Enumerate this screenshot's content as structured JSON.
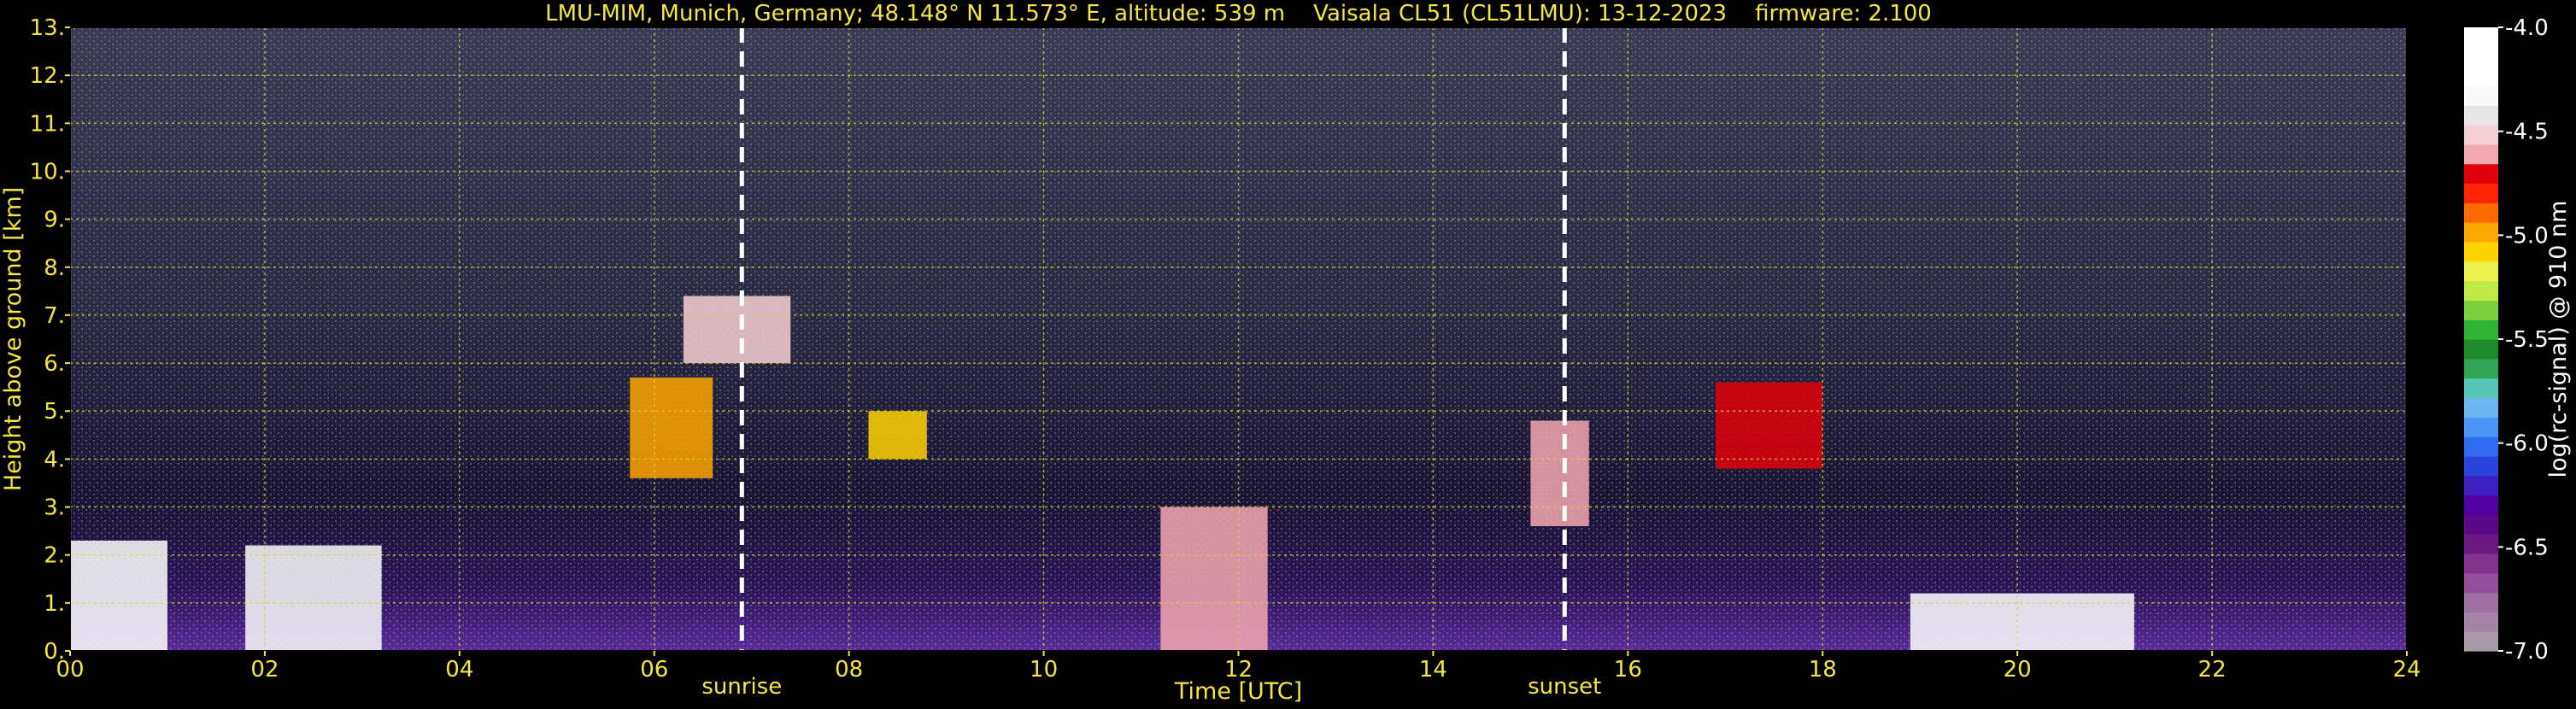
{
  "chart_data": {
    "type": "heatmap",
    "title": "LMU-MIM, Munich, Germany; 48.148° N 11.573° E, altitude: 539 m    Vaisala CL51 (CL51LMU): 13-12-2023    firmware: 2.100",
    "xlabel": "Time [UTC]",
    "ylabel": "Height above ground [km]",
    "xlim": [
      0,
      24
    ],
    "ylim": [
      0,
      13
    ],
    "x_ticks": [
      "00",
      "02",
      "04",
      "06",
      "08",
      "10",
      "12",
      "14",
      "16",
      "18",
      "20",
      "22",
      "24"
    ],
    "y_ticks": [
      "0.",
      "1.",
      "2.",
      "3.",
      "4.",
      "5.",
      "6.",
      "7.",
      "8.",
      "9.",
      "10.",
      "11.",
      "12.",
      "13."
    ],
    "grid": true,
    "markers": [
      {
        "label": "sunrise",
        "x": 6.9
      },
      {
        "label": "sunset",
        "x": 15.35
      }
    ],
    "colorbar": {
      "label": "log(rc-signal) @ 910 nm",
      "range": [
        -7.0,
        -4.0
      ],
      "ticks": [
        "-4.0",
        "-4.5",
        "-5.0",
        "-5.5",
        "-6.0",
        "-6.5",
        "-7.0"
      ],
      "tick_values": [
        -4.0,
        -4.5,
        -5.0,
        -5.5,
        -6.0,
        -6.5,
        -7.0
      ],
      "colors": [
        "#a89aa6",
        "#a585a5",
        "#a070a5",
        "#934f9a",
        "#81338d",
        "#6c1984",
        "#5a0a86",
        "#4e00a0",
        "#3d1fc2",
        "#2d43dd",
        "#2f6cf0",
        "#4b93f5",
        "#6cb7ef",
        "#56c7b7",
        "#33a656",
        "#1e8c2d",
        "#2eb334",
        "#7dd23b",
        "#c0ea48",
        "#eef24c",
        "#ffd400",
        "#ffa600",
        "#ff6a00",
        "#ff2500",
        "#e0000b",
        "#f3a8b0",
        "#f7d0d5",
        "#e8e3e6",
        "#fafafa",
        "#ffffff",
        "#ffffff",
        "#ffffff"
      ]
    },
    "features": [
      {
        "x0": 0.0,
        "x1": 1.0,
        "y0": 0.0,
        "y1": 2.3,
        "value": -4.2
      },
      {
        "x0": 1.8,
        "x1": 3.2,
        "y0": 0.0,
        "y1": 2.2,
        "value": -4.3
      },
      {
        "x0": 5.75,
        "x1": 6.6,
        "y0": 3.6,
        "y1": 5.7,
        "value": -5.0
      },
      {
        "x0": 6.3,
        "x1": 7.4,
        "y0": 6.0,
        "y1": 7.4,
        "value": -4.5
      },
      {
        "x0": 8.2,
        "x1": 8.8,
        "y0": 4.0,
        "y1": 5.0,
        "value": -5.1
      },
      {
        "x0": 11.2,
        "x1": 12.3,
        "y0": 0.0,
        "y1": 3.0,
        "value": -4.6
      },
      {
        "x0": 15.0,
        "x1": 15.6,
        "y0": 2.6,
        "y1": 4.8,
        "value": -4.6
      },
      {
        "x0": 16.9,
        "x1": 18.0,
        "y0": 3.8,
        "y1": 5.6,
        "value": -4.7
      },
      {
        "x0": 18.9,
        "x1": 21.2,
        "y0": 0.0,
        "y1": 1.2,
        "value": -4.2
      }
    ]
  }
}
